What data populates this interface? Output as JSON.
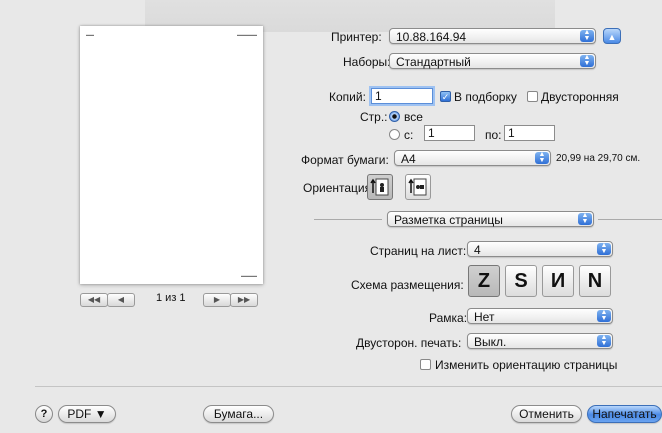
{
  "printer": {
    "label": "Принтер:",
    "value": "10.88.164.94"
  },
  "presets": {
    "label": "Наборы:",
    "value": "Стандартный"
  },
  "copies": {
    "label": "Копий:",
    "value": "1",
    "collate_label": "В подборку",
    "collate_checked": true,
    "duplex_label": "Двусторонняя",
    "duplex_checked": false
  },
  "pages": {
    "label": "Стр.:",
    "all_label": "все",
    "from_label": "с:",
    "from_value": "1",
    "to_label": "по:",
    "to_value": "1"
  },
  "paper": {
    "label": "Формат бумаги:",
    "value": "A4",
    "size_text": "20,99 на 29,70 см."
  },
  "orientation": {
    "label": "Ориентация:"
  },
  "section": {
    "value": "Разметка страницы"
  },
  "layout": {
    "pages_per_sheet_label": "Страниц на лист:",
    "pages_per_sheet_value": "4",
    "direction_label": "Схема размещения:",
    "direction_icons": [
      "Z",
      "S",
      "И",
      "N"
    ],
    "border_label": "Рамка:",
    "border_value": "Нет",
    "two_sided_label": "Двусторон. печать:",
    "two_sided_value": "Выкл.",
    "flip_label": "Изменить ориентацию страницы",
    "flip_checked": false
  },
  "preview": {
    "page_indicator": "1 из 1"
  },
  "footer": {
    "help": "?",
    "pdf_label": "PDF ▼",
    "paper_label": "Бумага...",
    "cancel_label": "Отменить",
    "print_label": "Напечатать"
  }
}
